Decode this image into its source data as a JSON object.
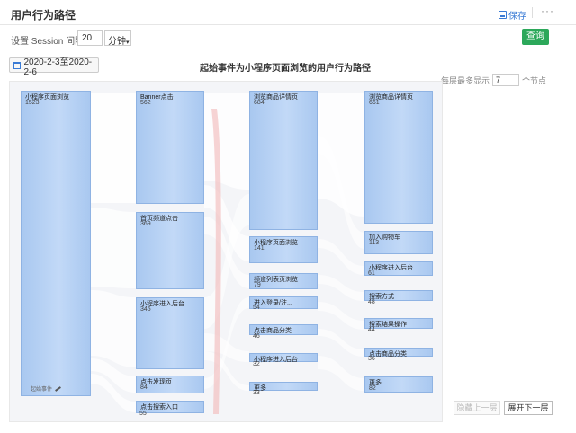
{
  "header": {
    "title": "用户行为路径",
    "save_label": "保存",
    "more_label": "···"
  },
  "filters": {
    "session_label": "设置 Session 间隔",
    "session_value": "20",
    "unit": "分钟",
    "unit_caret": "▾",
    "query_label": "查询"
  },
  "date_range": "2020-2-3至2020-2-6",
  "chart_title": "起始事件为小程序页面浏览的用户行为路径",
  "layer_limit": {
    "prefix": "每层最多显示",
    "value": "7",
    "suffix": "个节点"
  },
  "start_tag": "起始事件",
  "columns": [
    {
      "nodes": [
        {
          "label": "小程序页面浏览",
          "count": "1523"
        }
      ]
    },
    {
      "nodes": [
        {
          "label": "Banner点击",
          "count": "562"
        },
        {
          "label": "首页频道点击",
          "count": "369"
        },
        {
          "label": "小程序进入后台",
          "count": "345"
        },
        {
          "label": "点击发现页",
          "count": "84"
        },
        {
          "label": "点击搜索入口",
          "count": "55"
        }
      ]
    },
    {
      "nodes": [
        {
          "label": "浏览商品详情页",
          "count": "684"
        },
        {
          "label": "小程序页面浏览",
          "count": "141"
        },
        {
          "label": "频道列表页浏览",
          "count": "79"
        },
        {
          "label": "进入登录/注...",
          "count": "54"
        },
        {
          "label": "点击商品分类",
          "count": "46"
        },
        {
          "label": "小程序进入后台",
          "count": "32"
        },
        {
          "label": "更多",
          "count": "33"
        }
      ]
    },
    {
      "nodes": [
        {
          "label": "浏览商品详情页",
          "count": "661"
        },
        {
          "label": "加入购物车",
          "count": "113"
        },
        {
          "label": "小程序进入后台",
          "count": "61"
        },
        {
          "label": "搜索方式",
          "count": "48"
        },
        {
          "label": "搜索结果操作",
          "count": "44"
        },
        {
          "label": "点击商品分类",
          "count": "36"
        },
        {
          "label": "更多",
          "count": "82"
        }
      ]
    }
  ],
  "buttons": {
    "prev_layer": "隐藏上一层",
    "next_layer": "展开下一层"
  },
  "colors": {
    "node_fill": "#b7d1f4",
    "node_border": "#8fb3e3",
    "link": "#ffffff",
    "link_highlight": "#f2b8b8",
    "query": "#2ca85a",
    "accent": "#3a7bd5"
  }
}
